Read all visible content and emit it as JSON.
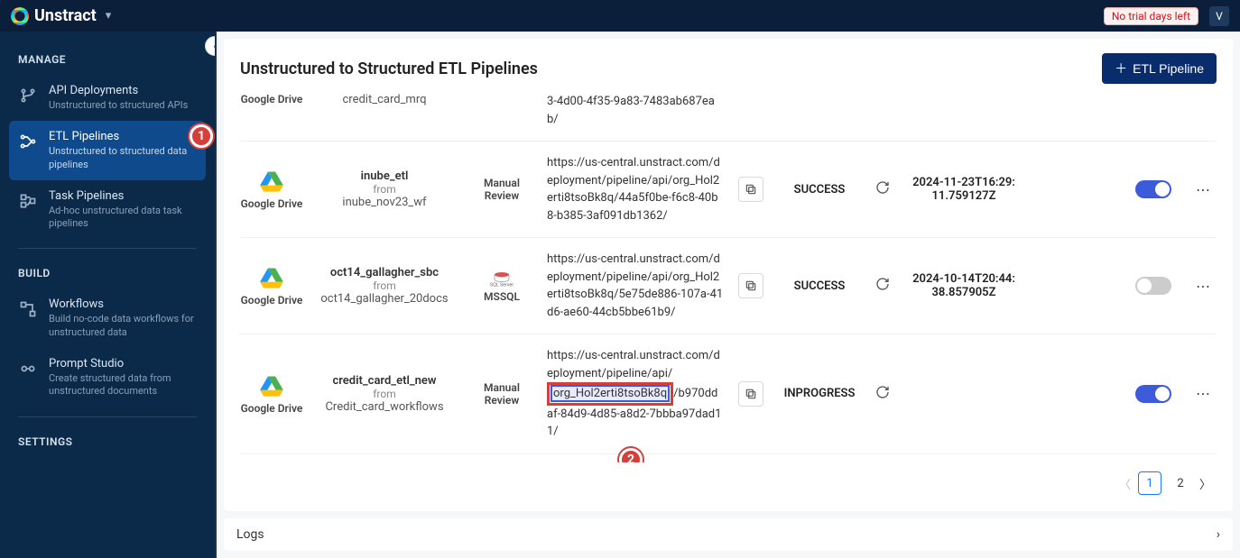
{
  "brand": "Unstract",
  "trial_badge": "No trial days left",
  "avatar_letter": "V",
  "sidebar": {
    "manage_title": "MANAGE",
    "build_title": "BUILD",
    "settings_title": "SETTINGS",
    "api": {
      "label": "API Deployments",
      "desc": "Unstructured to structured APIs"
    },
    "etl": {
      "label": "ETL Pipelines",
      "desc": "Unstructured to structured data pipelines"
    },
    "task": {
      "label": "Task Pipelines",
      "desc": "Ad-hoc unstructured data task pipelines"
    },
    "wf": {
      "label": "Workflows",
      "desc": "Build no-code data workflows for unstructured data"
    },
    "ps": {
      "label": "Prompt Studio",
      "desc": "Create structured data from unstructured documents"
    }
  },
  "page": {
    "title": "Unstructured to Structured ETL Pipelines",
    "add_btn": "ETL Pipeline"
  },
  "rows": [
    {
      "src_label": "Google Drive",
      "wf": "credit_card_mrq",
      "url": "3-4d00-4f35-9a83-7483ab687eab/"
    },
    {
      "src_label": "Google Drive",
      "name": "inube_etl",
      "from": "from",
      "wf": "inube_nov23_wf",
      "dest_label": "Manual Review",
      "url": "https://us-central.unstract.com/deployment/pipeline/api/org_Hol2erti8tsoBk8q/44a5f0be-f6c8-40b8-b385-3af091db1362/",
      "status": "SUCCESS",
      "time": "2024-11-23T16:29:11.759127Z",
      "switch": true
    },
    {
      "src_label": "Google Drive",
      "name": "oct14_gallagher_sbc",
      "from": "from",
      "wf": "oct14_gallagher_20docs",
      "dest_label": "MSSQL",
      "url": "https://us-central.unstract.com/deployment/pipeline/api/org_Hol2erti8tsoBk8q/5e75de886-107a-41d6-ae60-44cb5bbe61b9/",
      "status": "SUCCESS",
      "time": "2024-10-14T20:44:38.857905Z",
      "switch": false
    },
    {
      "src_label": "Google Drive",
      "name": "credit_card_etl_new",
      "from": "from",
      "wf": "Credit_card_workflows",
      "dest_label": "Manual Review",
      "url_pre": "https://us-central.unstract.com/deployment/pipeline/api/",
      "url_hl": "org_Hol2erti8tsoBk8q",
      "url_post": "/b970ddaf-84d9-4d85-a8d2-7bbba97dad11/",
      "status": "INPROGRESS",
      "time": "",
      "switch": true
    }
  ],
  "pagination": {
    "p1": "1",
    "p2": "2"
  },
  "logs_label": "Logs",
  "callouts": {
    "c1": "1",
    "c2": "2"
  }
}
